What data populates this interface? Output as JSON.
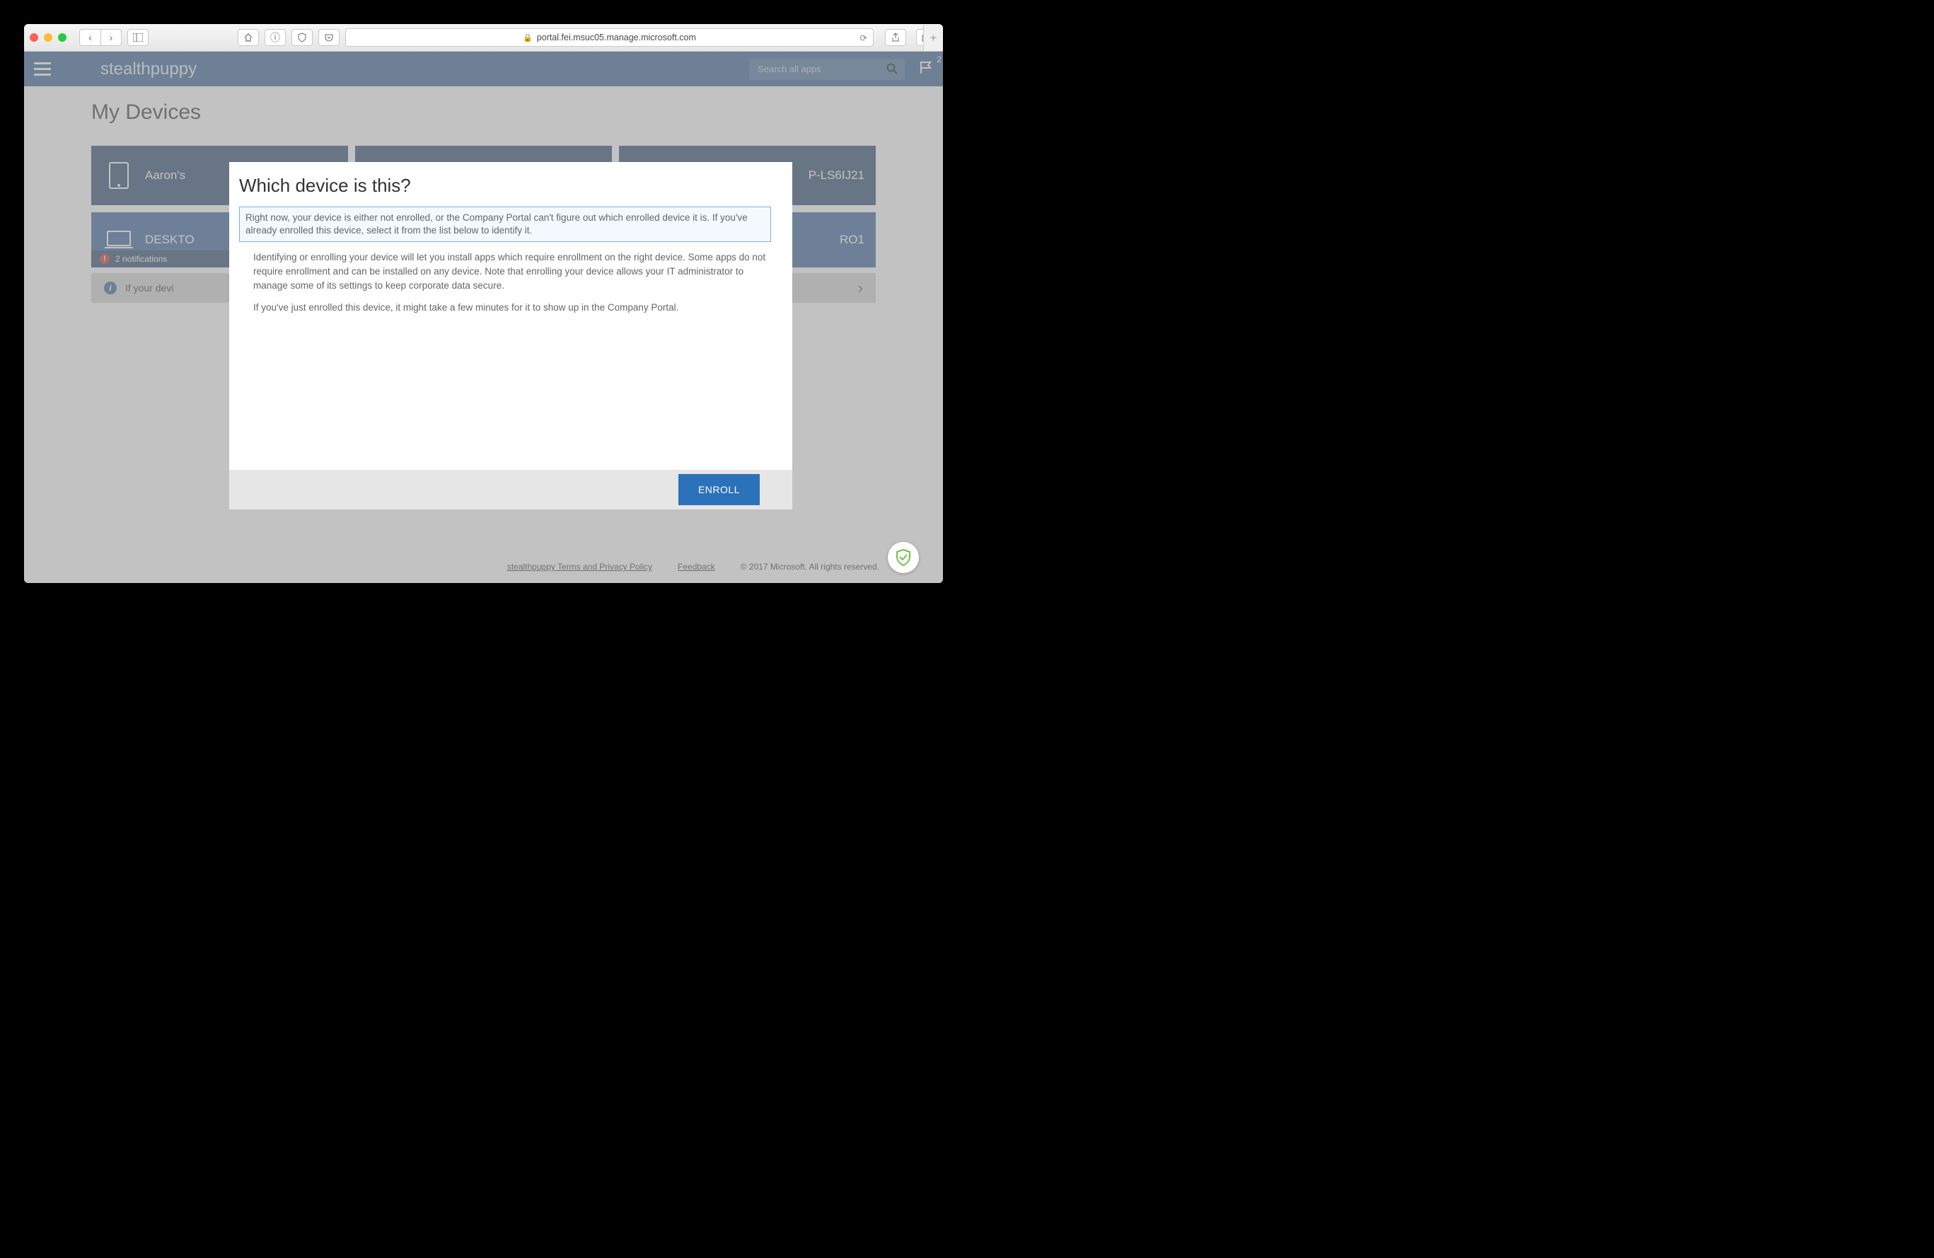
{
  "browser": {
    "url_host": "portal.fei.msuc05.manage.microsoft.com"
  },
  "portalHeader": {
    "brand": "stealthpuppy",
    "search_placeholder": "Search all apps",
    "flag_count": "2"
  },
  "page": {
    "title": "My Devices"
  },
  "devices": {
    "row1": [
      {
        "name": "Aaron's"
      },
      {
        "name": ""
      },
      {
        "name": "P-LS6IJ21"
      }
    ],
    "row2": [
      {
        "name": "DESKTO",
        "alert": "2 notifications"
      },
      {
        "name": ""
      },
      {
        "name": "RO1"
      }
    ]
  },
  "infoBar": {
    "text": "If your devi"
  },
  "modal": {
    "title": "Which device is this?",
    "highlight": "Right now, your device is either not enrolled, or the Company Portal can't figure out which enrolled device it is. If you've already enrolled this device, select it from the list below to identify it.",
    "para1": "Identifying or enrolling your device will let you install apps which require enrollment on the right device. Some apps do not require enrollment and can be installed on any device. Note that enrolling your device allows your IT administrator to manage some of its settings to keep corporate data secure.",
    "para2": "If you've just enrolled this device, it might take a few minutes for it to show up in the Company Portal.",
    "enroll_label": "ENROLL"
  },
  "footer": {
    "terms": "stealthpuppy Terms and Privacy Policy",
    "feedback": "Feedback",
    "copyright": "© 2017 Microsoft. All rights reserved."
  }
}
